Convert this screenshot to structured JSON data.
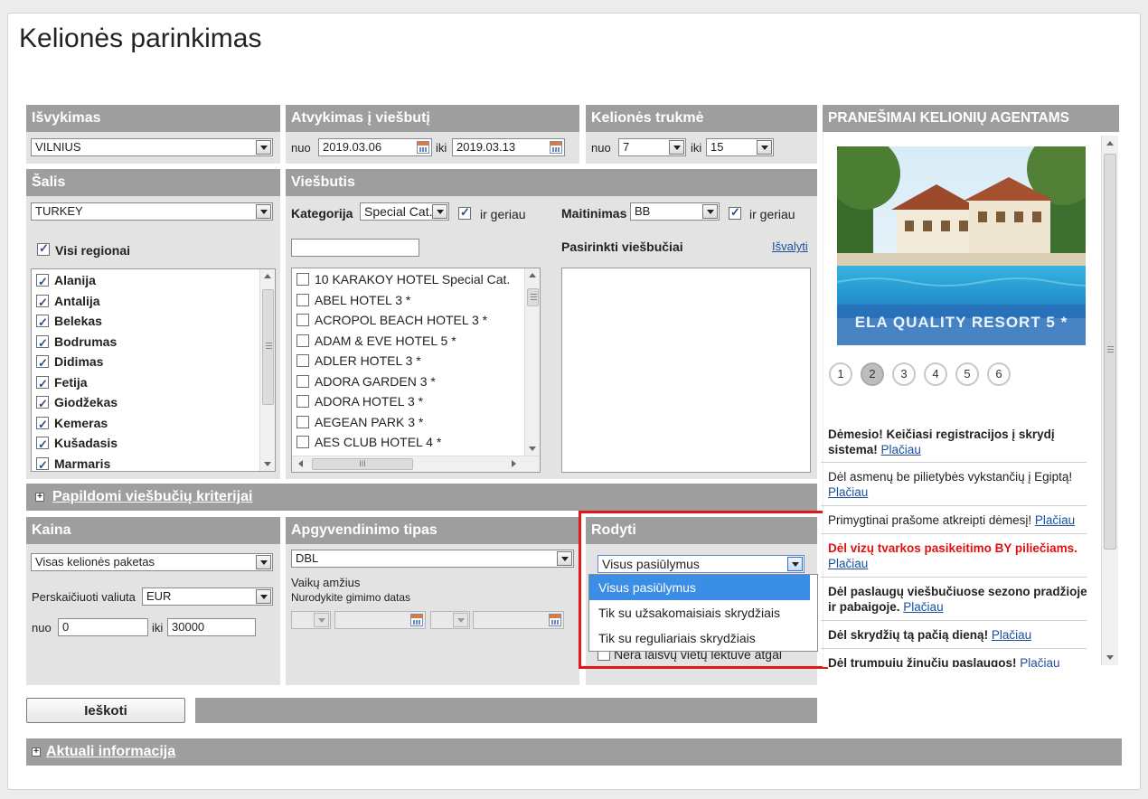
{
  "page": {
    "title": "Kelionės parinkimas"
  },
  "departure": {
    "header": "Išvykimas",
    "city": "VILNIUS"
  },
  "arrival": {
    "header": "Atvykimas į viešbutį",
    "from_label": "nuo",
    "from_date": "2019.03.06",
    "to_label": "iki",
    "to_date": "2019.03.13"
  },
  "duration": {
    "header": "Kelionės trukmė",
    "from_label": "nuo",
    "from_value": "7",
    "to_label": "iki",
    "to_value": "15"
  },
  "country": {
    "header": "Šalis",
    "value": "TURKEY",
    "all_regions_label": "Visi regionai",
    "regions": [
      "Alanija",
      "Antalija",
      "Belekas",
      "Bodrumas",
      "Didimas",
      "Fetija",
      "Giodžekas",
      "Kemeras",
      "Kušadasis",
      "Marmaris"
    ]
  },
  "hotel": {
    "header": "Viešbutis",
    "category_label": "Kategorija",
    "category_value": "Special Cat.",
    "better_label": "ir geriau",
    "meal_label": "Maitinimas",
    "meal_value": "BB",
    "meal_better_label": "ir geriau",
    "search_value": "",
    "selected_label": "Pasirinkti viešbučiai",
    "clear_link": "Išvalyti",
    "hotels": [
      "10 KARAKOY HOTEL Special Cat.",
      "ABEL HOTEL 3 *",
      "ACROPOL BEACH HOTEL 3 *",
      "ADAM & EVE HOTEL 5 *",
      "ADLER HOTEL 3 *",
      "ADORA GARDEN 3 *",
      "ADORA HOTEL 3 *",
      "AEGEAN PARK 3 *",
      "AES CLUB HOTEL 4 *"
    ],
    "scroll_mid_glyph": "III"
  },
  "extra_criteria": {
    "label": "Papildomi viešbučių kriterijai"
  },
  "price": {
    "header": "Kaina",
    "package_value": "Visas kelionės paketas",
    "currency_label": "Perskaičiuoti valiuta",
    "currency_value": "EUR",
    "from_label": "nuo",
    "from_value": "0",
    "to_label": "iki",
    "to_value": "30000"
  },
  "accommodation": {
    "header": "Apgyvendinimo tipas",
    "value": "DBL",
    "children_label": "Vaikų amžius",
    "children_hint": "Nurodykite gimimo datas"
  },
  "show": {
    "header": "Rodyti",
    "value": "Visus pasiūlymus",
    "options": [
      "Visus pasiūlymus",
      "Tik su užsakomaisiais skrydžiais",
      "Tik su reguliariais skrydžiais"
    ],
    "no_seats_label": "Nėra laisvų vietų lėktuve atgal"
  },
  "search_button": "Ieškoti",
  "current_info": {
    "label": "Aktuali informacija"
  },
  "agents": {
    "header": "PRANEŠIMAI KELIONIŲ AGENTAMS",
    "banner_caption": "ELA QUALITY RESORT 5 *",
    "pages": [
      "1",
      "2",
      "3",
      "4",
      "5",
      "6"
    ],
    "news": [
      {
        "text": "Dėmesio! Keičiasi registracijos į skrydį sistema!",
        "link": "Plačiau"
      },
      {
        "text": "Dėl asmenų be pilietybės vykstančių į Egiptą!",
        "link": "Plačiau"
      },
      {
        "text": "Primygtinai prašome atkreipti dėmesį!",
        "link": "Plačiau"
      },
      {
        "text": "Dėl vizų tvarkos pasikeitimo BY piliečiams.",
        "link": "Plačiau"
      },
      {
        "text": "Dėl paslaugų viešbučiuose sezono pradžioje ir pabaigoje.",
        "link": "Plačiau"
      },
      {
        "text": "Dėl skrydžių tą pačią dieną!",
        "link": "Plačiau"
      },
      {
        "text": "Dėl trumpųjų žinučių paslaugos!",
        "link": "Plačiau"
      }
    ]
  },
  "colors": {
    "header_bg": "#9e9e9e",
    "panel_bg": "#e3e3e3",
    "highlight_border": "#e01818",
    "selected_option": "#3a8ee6",
    "alert_text": "#e01010",
    "link": "#1a4f9e"
  }
}
